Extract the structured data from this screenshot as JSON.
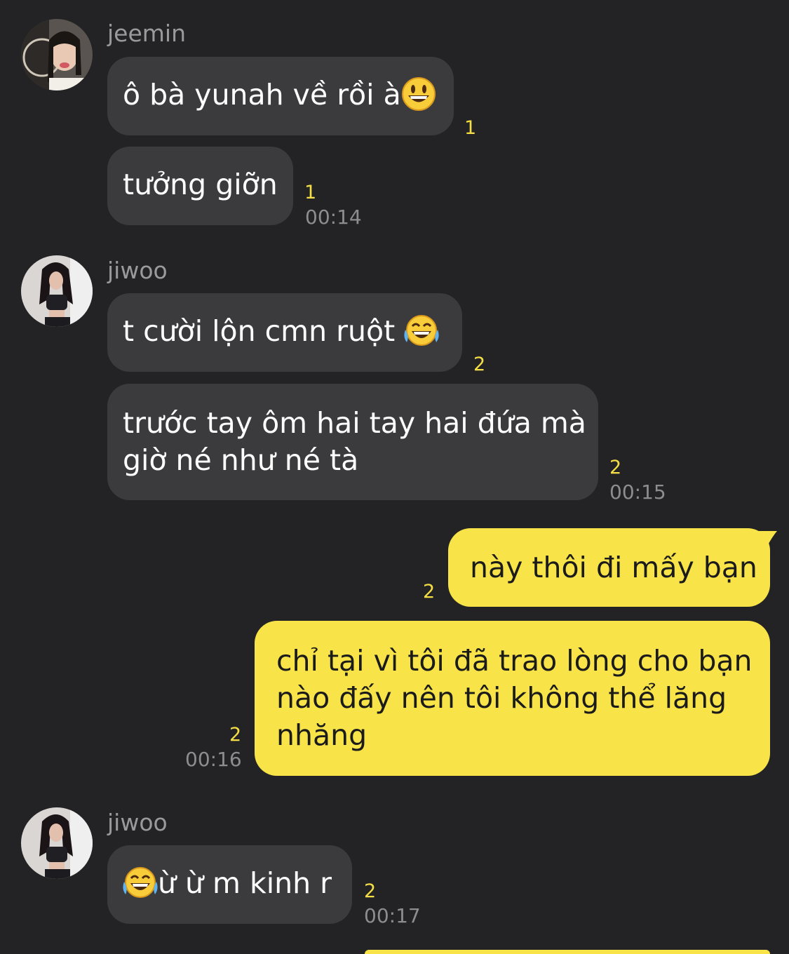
{
  "messages": {
    "m1": {
      "sender": "jeemin",
      "text": "ô bà yunah về rồi à",
      "emoji": "grinning-face-emoji",
      "unread": "1"
    },
    "m2": {
      "text": "tưởng giỡn",
      "unread": "1",
      "time": "00:14"
    },
    "m3": {
      "sender": "jiwoo",
      "text": "t cười lộn cmn ruột ",
      "emoji": "tears-of-joy-emoji",
      "unread": "2"
    },
    "m4": {
      "line1": "trước tay ôm hai tay hai đứa mà",
      "line2": "giờ né như né tà",
      "unread": "2",
      "time": "00:15"
    },
    "m5": {
      "text": "này thôi đi mấy bạn",
      "unread": "2"
    },
    "m6": {
      "line1": "chỉ tại vì tôi đã trao lòng cho bạn",
      "line2": "nào đấy nên tôi không thể lăng",
      "line3": "nhăng",
      "unread": "2",
      "time": "00:16"
    },
    "m7": {
      "sender": "jiwoo",
      "text": "ừ ừ m kinh r",
      "emoji": "tears-of-joy-emoji",
      "unread": "2",
      "time": "00:17"
    }
  },
  "colors": {
    "background": "#232325",
    "incoming_bubble": "#3b3b3e",
    "outgoing_bubble": "#f8e449",
    "unread_count": "#f5de45",
    "timestamp": "#8d8d90"
  }
}
